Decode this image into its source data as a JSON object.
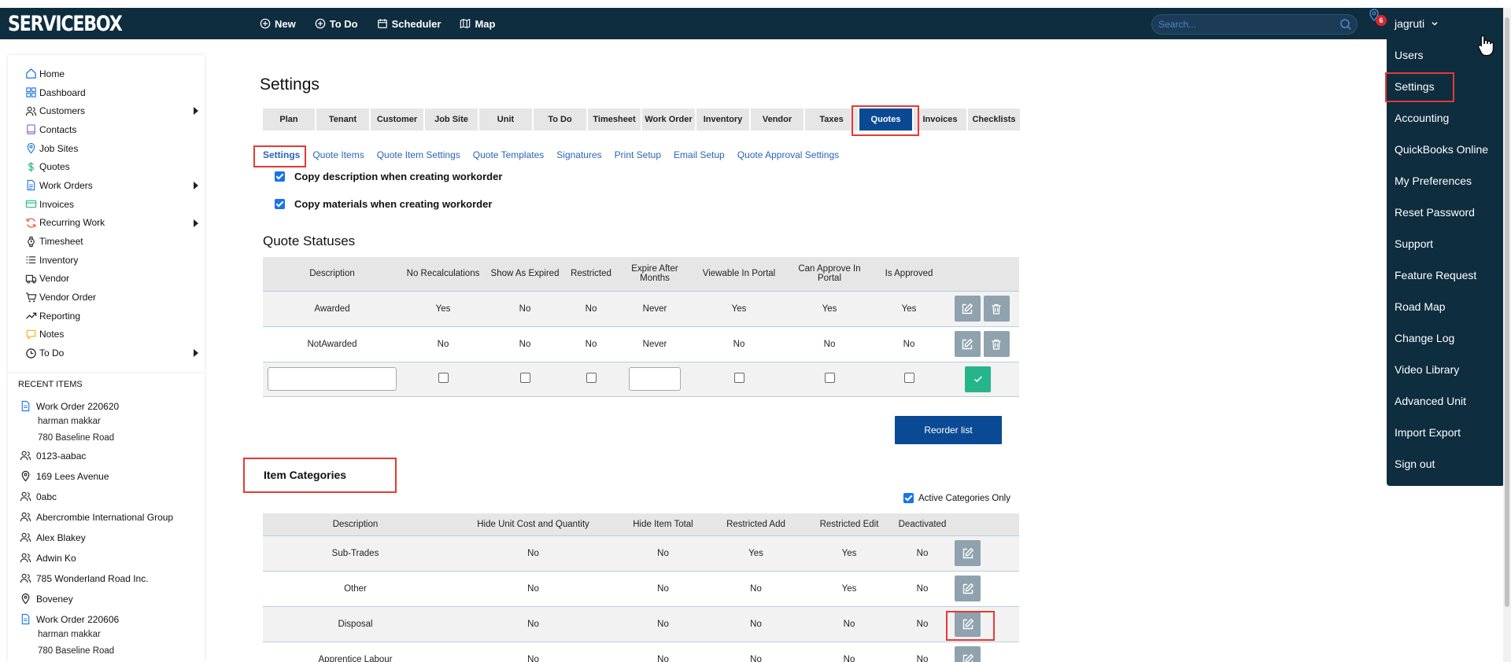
{
  "app": {
    "brand": "SERVICEBOX"
  },
  "topnav": [
    {
      "label": "New",
      "icon": "plus-circle-icon"
    },
    {
      "label": "To Do",
      "icon": "plus-circle-icon"
    },
    {
      "label": "Scheduler",
      "icon": "calendar-icon"
    },
    {
      "label": "Map",
      "icon": "map-icon"
    }
  ],
  "search": {
    "placeholder": "Search..."
  },
  "notifications": {
    "count": "6"
  },
  "user": {
    "name": "jagruti"
  },
  "sidebar": {
    "items": [
      {
        "label": "Home",
        "icon": "home-icon"
      },
      {
        "label": "Dashboard",
        "icon": "dashboard-icon"
      },
      {
        "label": "Customers",
        "icon": "users-icon"
      },
      {
        "label": "Contacts",
        "icon": "book-icon"
      },
      {
        "label": "Job Sites",
        "icon": "location-pin-icon"
      },
      {
        "label": "Quotes",
        "icon": "dollar-icon"
      },
      {
        "label": "Work Orders",
        "icon": "document-icon"
      },
      {
        "label": "Invoices",
        "icon": "credit-card-icon"
      },
      {
        "label": "Recurring Work",
        "icon": "refresh-icon"
      },
      {
        "label": "Timesheet",
        "icon": "watch-icon"
      },
      {
        "label": "Inventory",
        "icon": "list-icon"
      },
      {
        "label": "Vendor",
        "icon": "truck-icon"
      },
      {
        "label": "Vendor Order",
        "icon": "cart-icon"
      },
      {
        "label": "Reporting",
        "icon": "trend-icon"
      },
      {
        "label": "Notes",
        "icon": "comment-icon"
      },
      {
        "label": "To Do",
        "icon": "clock-icon"
      }
    ]
  },
  "recent": {
    "title": "RECENT ITEMS",
    "items": [
      {
        "label": "Work Order 220620",
        "icon": "document-icon",
        "sub1": "harman makkar",
        "sub2": "780 Baseline Road"
      },
      {
        "label": "0123-aabac",
        "icon": "users-icon"
      },
      {
        "label": "169 Lees Avenue",
        "icon": "location-pin-icon"
      },
      {
        "label": "0abc",
        "icon": "users-icon"
      },
      {
        "label": "Abercrombie International Group",
        "icon": "users-icon"
      },
      {
        "label": "Alex Blakey",
        "icon": "users-icon"
      },
      {
        "label": "Adwin Ko",
        "icon": "users-icon"
      },
      {
        "label": "785 Wonderland Road Inc.",
        "icon": "users-icon"
      },
      {
        "label": "Boveney",
        "icon": "location-pin-icon"
      },
      {
        "label": "Work Order 220606",
        "icon": "document-icon",
        "sub1": "harman makkar",
        "sub2": "780 Baseline Road"
      }
    ]
  },
  "page": {
    "title": "Settings"
  },
  "tabs": [
    "Plan",
    "Tenant",
    "Customer",
    "Job Site",
    "Unit",
    "To Do",
    "Timesheet",
    "Work Order",
    "Inventory",
    "Vendor",
    "Taxes",
    "Quotes",
    "Invoices",
    "Checklists"
  ],
  "subtabs": [
    "Settings",
    "Quote Items",
    "Quote Item Settings",
    "Quote Templates",
    "Signatures",
    "Print Setup",
    "Email Setup",
    "Quote Approval Settings"
  ],
  "options": {
    "copy_description": "Copy description when creating workorder",
    "copy_materials": "Copy materials when creating workorder"
  },
  "quote_statuses": {
    "title": "Quote Statuses",
    "headers": [
      "Description",
      "No Recalculations",
      "Show As Expired",
      "Restricted",
      "Expire After Months",
      "Viewable In Portal",
      "Can Approve In Portal",
      "Is Approved"
    ],
    "rows": [
      [
        "Awarded",
        "Yes",
        "No",
        "No",
        "Never",
        "Yes",
        "Yes",
        "Yes"
      ],
      [
        "NotAwarded",
        "No",
        "No",
        "No",
        "Never",
        "No",
        "No",
        "No"
      ]
    ],
    "reorder_label": "Reorder list"
  },
  "item_categories": {
    "title": "Item Categories",
    "active_only_label": "Active Categories Only",
    "headers": [
      "Description",
      "Hide Unit Cost and Quantity",
      "Hide Item Total",
      "Restricted Add",
      "Restricted Edit",
      "Deactivated"
    ],
    "rows": [
      [
        "Sub-Trades",
        "No",
        "No",
        "Yes",
        "Yes",
        "No"
      ],
      [
        "Other",
        "No",
        "No",
        "No",
        "Yes",
        "No"
      ],
      [
        "Disposal",
        "No",
        "No",
        "No",
        "No",
        "No"
      ],
      [
        "Apprentice Labour",
        "No",
        "No",
        "No",
        "No",
        "No"
      ]
    ]
  },
  "user_menu": [
    "Users",
    "Settings",
    "Accounting",
    "QuickBooks Online",
    "My Preferences",
    "Reset Password",
    "Support",
    "Feature Request",
    "Road Map",
    "Change Log",
    "Video Library",
    "Advanced Unit",
    "Import Export",
    "Sign out"
  ],
  "colors": {
    "navbar": "#0e2d3f",
    "accent": "#0a4a94",
    "link": "#2a66b8",
    "highlight": "#e53935",
    "confirm": "#26b58a"
  }
}
